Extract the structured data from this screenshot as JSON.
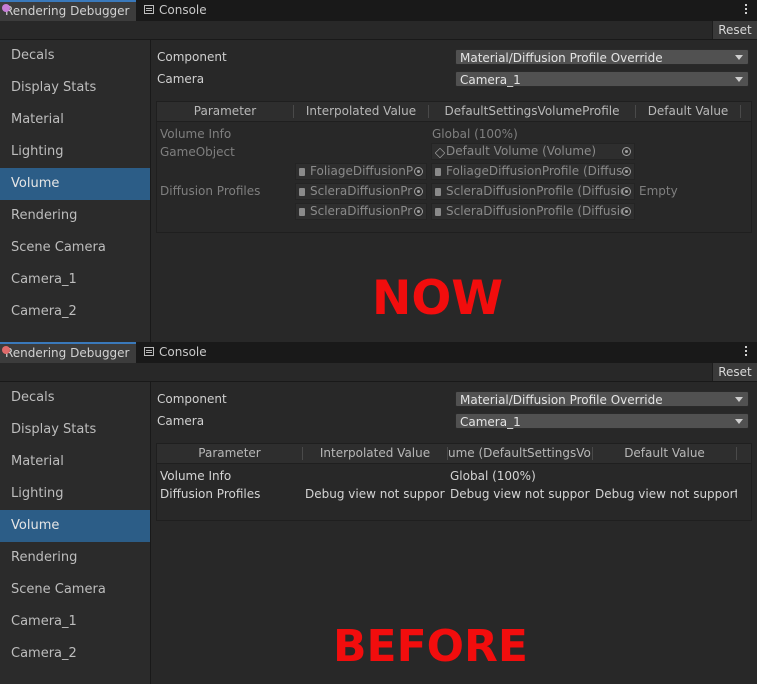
{
  "top": {
    "debugger_tab": "Rendering Debugger",
    "console_tab": "Console",
    "reset_label": "Reset",
    "sidebar": [
      "Decals",
      "Display Stats",
      "Material",
      "Lighting",
      "Volume",
      "Rendering",
      "Scene Camera",
      "Camera_1",
      "Camera_2"
    ],
    "component_label": "Component",
    "component_value": "Material/Diffusion Profile Override",
    "camera_label": "Camera",
    "camera_value": "Camera_1",
    "headers": [
      "Parameter",
      "Interpolated Value",
      "DefaultSettingsVolumeProfile",
      "Default Value"
    ],
    "rows": {
      "volume_info": "Volume Info",
      "volume_info_value": "Global (100%)",
      "gameobject": "GameObject",
      "gameobject_value": "Default Volume (Volume)",
      "diffusion": "Diffusion Profiles",
      "interp": [
        "FoliageDiffusionP",
        "ScleraDiffusionPr",
        "ScleraDiffusionPr"
      ],
      "profile": [
        "FoliageDiffusionProfile (Diffus",
        "ScleraDiffusionProfile (Diffusic",
        "ScleraDiffusionProfile (Diffusic"
      ],
      "default": "Empty"
    },
    "stamp": "NOW"
  },
  "bottom": {
    "debugger_tab": "Rendering Debugger",
    "console_tab": "Console",
    "reset_label": "Reset",
    "sidebar": [
      "Decals",
      "Display Stats",
      "Material",
      "Lighting",
      "Volume",
      "Rendering",
      "Scene Camera",
      "Camera_1",
      "Camera_2"
    ],
    "component_label": "Component",
    "component_value": "Material/Diffusion Profile Override",
    "camera_label": "Camera",
    "camera_value": "Camera_1",
    "headers": [
      "Parameter",
      "Interpolated Value",
      "ume (DefaultSettingsVolu",
      "Default Value"
    ],
    "rows": {
      "volume_info": "Volume Info",
      "volume_info_value": "Global (100%)",
      "diffusion": "Diffusion Profiles",
      "not_supported": [
        "Debug view not supporte",
        "Debug view not supporte",
        "Debug view not supporte"
      ]
    },
    "stamp": "BEFORE"
  },
  "colors": {
    "selection": "#2c5d87",
    "stamp": "#f20d0d",
    "dot_top": "#c77dd8",
    "dot_bottom": "#e06b6b"
  },
  "icons": [
    "kebab-menu-icon",
    "console-icon",
    "dropdown-arrow-icon",
    "object-picker-icon",
    "scriptable-object-icon",
    "volume-cube-icon"
  ]
}
